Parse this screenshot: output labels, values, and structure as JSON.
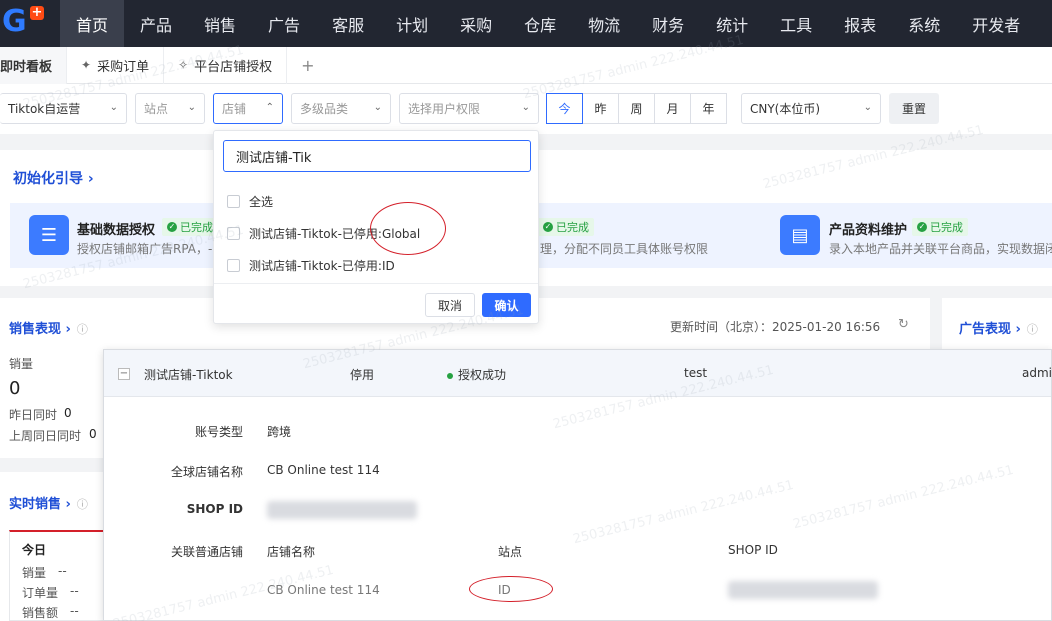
{
  "nav": {
    "items": [
      "首页",
      "产品",
      "销售",
      "广告",
      "客服",
      "计划",
      "采购",
      "仓库",
      "物流",
      "财务",
      "统计",
      "工具",
      "报表",
      "系统",
      "开发者"
    ],
    "active_index": 0
  },
  "tabs": [
    {
      "label": "即时看板",
      "active": true
    },
    {
      "label": "采购订单",
      "icon": "pin-icon"
    },
    {
      "label": "平台店铺授权",
      "icon": "pin-outline-icon"
    }
  ],
  "tab_add": "+",
  "filters": {
    "platform": "Tiktok自运营",
    "site": "站点",
    "shop": "店铺",
    "category": "多级品类",
    "user_perm": "选择用户权限",
    "periods": [
      "今",
      "昨",
      "周",
      "月",
      "年"
    ],
    "period_active": 0,
    "currency": "CNY(本位币)",
    "reset": "重置"
  },
  "shop_dropdown": {
    "search_value": "测试店铺-Tik",
    "options": [
      "全选",
      "测试店铺-Tiktok-已停用:Global",
      "测试店铺-Tiktok-已停用:ID"
    ],
    "cancel": "取消",
    "confirm": "确认"
  },
  "init_guide": {
    "title": "初始化引导 ›",
    "steps": [
      {
        "title": "基础数据授权",
        "status": "已完成",
        "desc": "授权店铺邮箱广告RPA，-"
      },
      {
        "title": "",
        "status": "已完成",
        "desc": "理，分配不同员工具体账号权限"
      },
      {
        "title": "产品资料维护",
        "status": "已完成",
        "desc": "录入本地产品并关联平台商品，实现数据闭"
      }
    ]
  },
  "sales_perf": {
    "title": "销售表现 ›",
    "metric_label": "销量",
    "metric_value": "0",
    "yesterday_label": "昨日同时",
    "yesterday_value": "0",
    "lastweek_label": "上周同日同时",
    "lastweek_value": "0",
    "update_time": "更新时间（北京）：2025-01-20 16:56"
  },
  "ad_perf": {
    "title": "广告表现 ›"
  },
  "realtime_sales": {
    "title": "实时销售 ›",
    "today": "今日",
    "rows": [
      {
        "label": "销量",
        "value": "--"
      },
      {
        "label": "订单量",
        "value": "--"
      },
      {
        "label": "销售额",
        "value": "--"
      }
    ]
  },
  "detail_panel": {
    "header": {
      "shop": "测试店铺-Tiktok",
      "state": "停用",
      "auth": "授权成功",
      "user": "test",
      "extra": "admi"
    },
    "account_type_label": "账号类型",
    "account_type": "跨境",
    "global_shop_label": "全球店铺名称",
    "global_shop": "CB Online test 114",
    "shop_id_label": "SHOP ID",
    "linked_label": "关联普通店铺",
    "linked_cols": [
      "店铺名称",
      "站点",
      "SHOP ID"
    ],
    "linked_row": {
      "name": "CB Online test 114",
      "site": "ID"
    }
  },
  "watermark": "2503281757 admin 222.240.44.51",
  "colors": {
    "primary": "#2f6bff",
    "nav_bg": "#222631",
    "success": "#26a142",
    "annotation": "#d4202a"
  }
}
